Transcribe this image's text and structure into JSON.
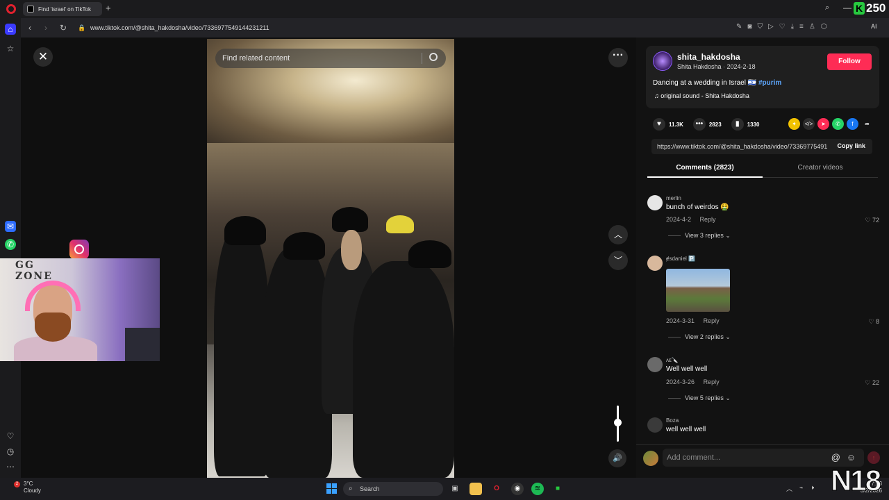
{
  "browser": {
    "tab_title": "Find 'israel' on TikTok",
    "url": "www.tiktok.com/@shita_hakdosha/video/7336977549144231211",
    "badge_letter": "K",
    "badge_number": "250",
    "ai_label": "AI"
  },
  "player": {
    "search_placeholder": "Find related content"
  },
  "post": {
    "username": "shita_hakdosha",
    "subline": "Shita Hakdosha · 2024-2-18",
    "follow_label": "Follow",
    "description": "Dancing at a wedding in Israel 🇮🇱",
    "hashtag": "#purim",
    "sound": "original sound - Shita Hakdosha",
    "likes": "11.3K",
    "comments_count": "2823",
    "saves": "1330",
    "share_link": "https://www.tiktok.com/@shita_hakdosha/video/7336977549144231211",
    "copy_link_label": "Copy link"
  },
  "tabs": {
    "comments": "Comments (2823)",
    "creator": "Creator videos"
  },
  "comments": [
    {
      "name": "merlin",
      "text": "bunch of weirdos 🤮",
      "date": "2024-4-2",
      "reply": "Reply",
      "likes": "72",
      "replies": "View 3 replies"
    },
    {
      "name": "ɇsdaniel 🅿️",
      "text": "",
      "date": "2024-3-31",
      "reply": "Reply",
      "likes": "8",
      "replies": "View 2 replies"
    },
    {
      "name": "ᴧᴇ🔪",
      "text": "Well well well",
      "date": "2024-3-26",
      "reply": "Reply",
      "likes": "22",
      "replies": "View 5 replies"
    },
    {
      "name": "Boza",
      "text": "well well well",
      "date": "",
      "reply": "",
      "likes": "",
      "replies": ""
    }
  ],
  "add_comment": {
    "placeholder": "Add comment..."
  },
  "webcam": {
    "logo_text": "GG\nZONE"
  },
  "taskbar": {
    "temp": "3°C",
    "weather": "Cloudy",
    "weather_badge": "2",
    "search_placeholder": "Search",
    "time": "7:53",
    "date": "3/2/2026"
  },
  "watermark": "N18",
  "colors": {
    "follow": "#fe2c55",
    "hashtag": "#5ea8ff",
    "opera": "#e0212e"
  }
}
